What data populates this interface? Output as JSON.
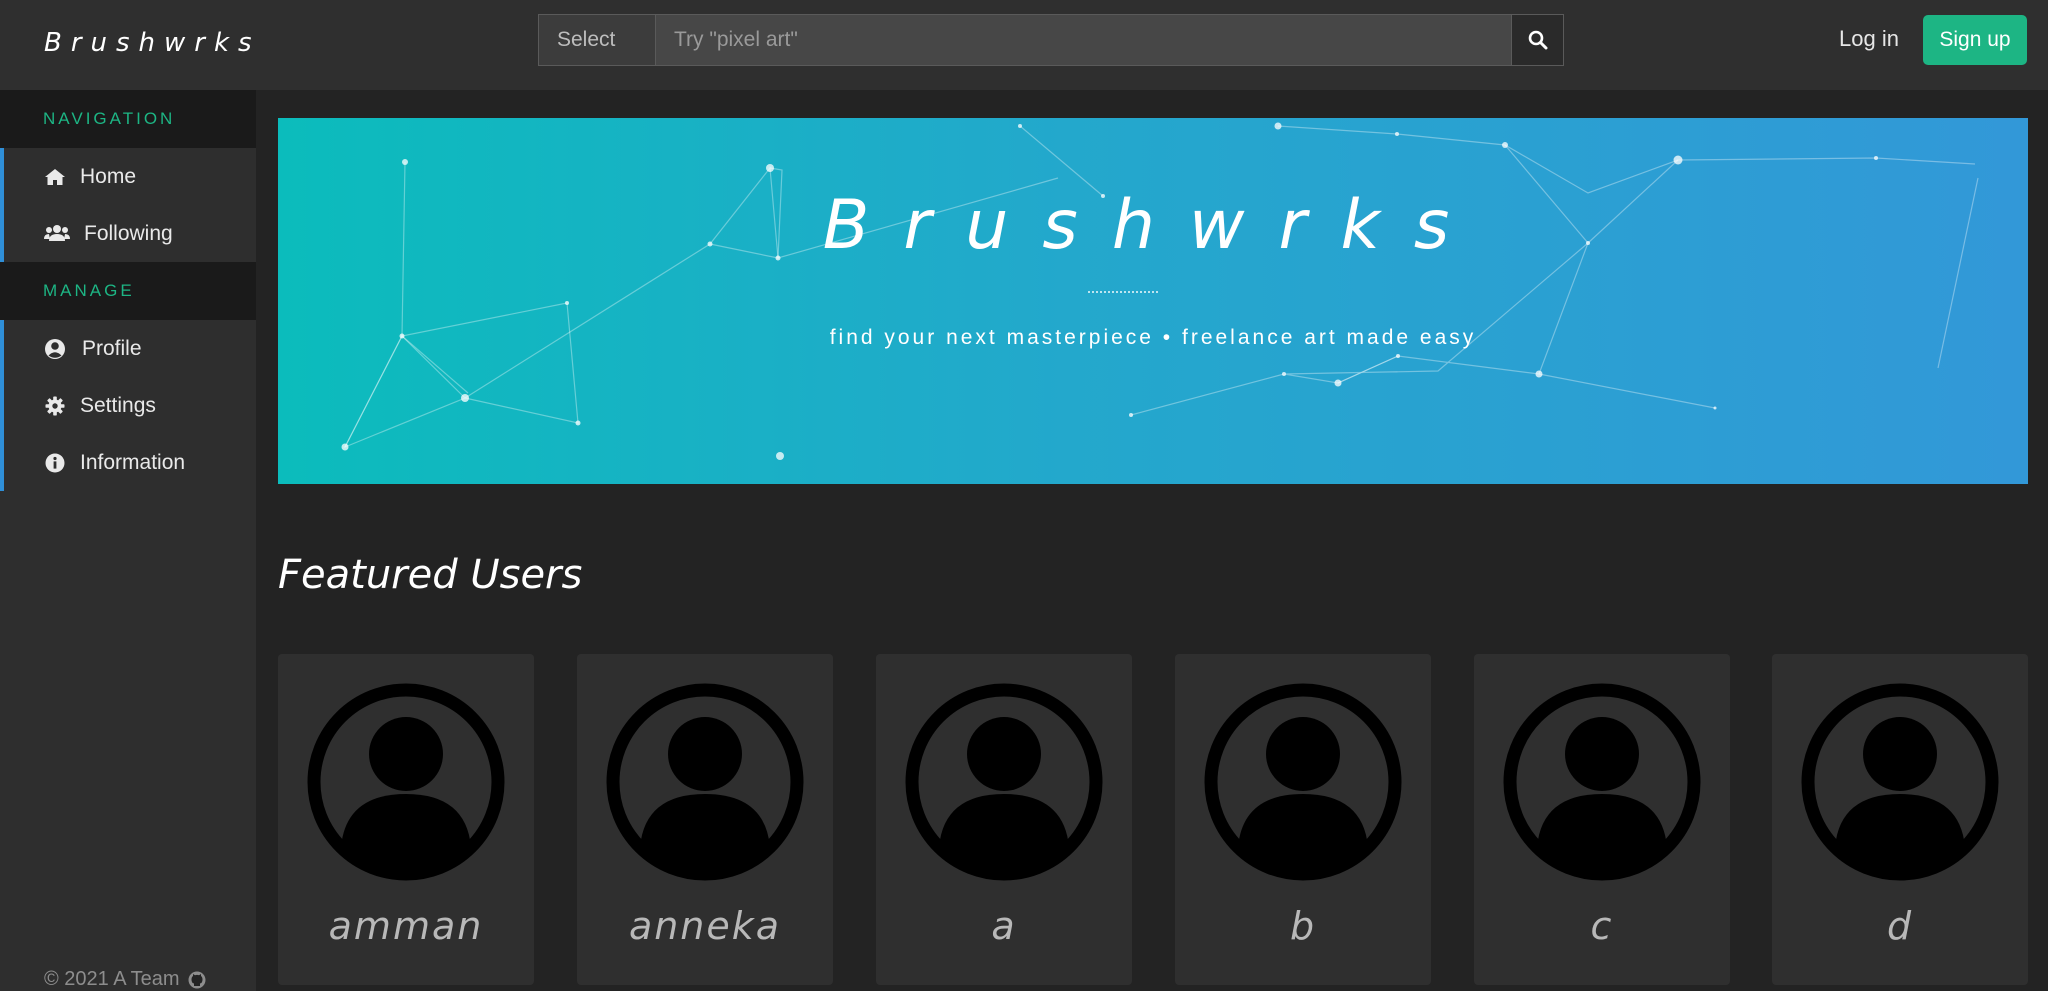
{
  "header": {
    "logo": "Brushwrks",
    "select_label": "Select",
    "search_placeholder": "Try \"pixel art\"",
    "login_label": "Log in",
    "signup_label": "Sign up"
  },
  "sidebar": {
    "sections": [
      {
        "title": "NAVIGATION",
        "items": [
          {
            "label": "Home",
            "icon": "home-icon"
          },
          {
            "label": "Following",
            "icon": "users-icon"
          }
        ]
      },
      {
        "title": "MANAGE",
        "items": [
          {
            "label": "Profile",
            "icon": "user-circle-icon"
          },
          {
            "label": "Settings",
            "icon": "gear-icon"
          },
          {
            "label": "Information",
            "icon": "info-icon"
          }
        ]
      }
    ],
    "footer": "© 2021 A Team"
  },
  "banner": {
    "title": "Brushwrks",
    "subtitle": "find your next masterpiece • freelance art made easy"
  },
  "featured": {
    "title": "Featured Users",
    "users": [
      {
        "name": "amman"
      },
      {
        "name": "anneka"
      },
      {
        "name": "a"
      },
      {
        "name": "b"
      },
      {
        "name": "c"
      },
      {
        "name": "d"
      }
    ]
  },
  "colors": {
    "accent": "#1db584",
    "sidebar_marker": "#2f8fd8",
    "banner_start": "#0bbcbc",
    "banner_end": "#3298d8"
  }
}
